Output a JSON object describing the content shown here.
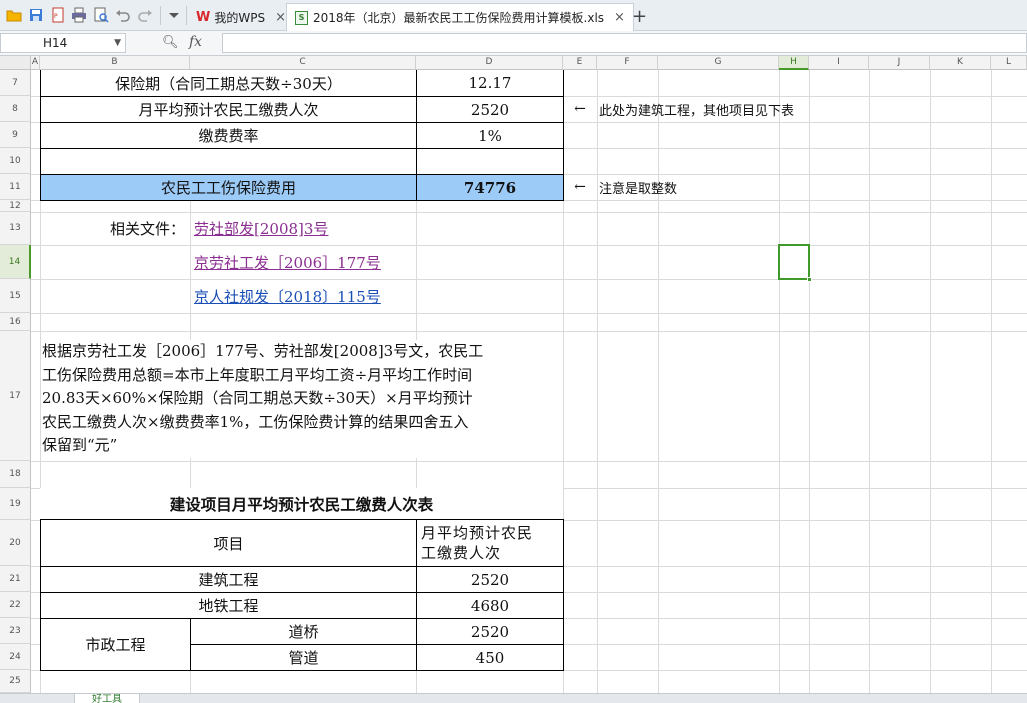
{
  "toolbar": {
    "icons": [
      "open-folder-icon",
      "save-icon",
      "export-pdf-icon",
      "print-icon",
      "print-preview-icon",
      "undo-icon",
      "redo-icon",
      "more-dropdown-icon"
    ]
  },
  "tabs": [
    {
      "label": "我的WPS",
      "close": "×",
      "active": false
    },
    {
      "label": "2018年（北京）最新农民工工伤保险费用计算模板.xls",
      "close": "×",
      "active": true
    }
  ],
  "new_tab": "+",
  "formula_bar": {
    "cell_ref": "H14",
    "fx": "fx",
    "content": ""
  },
  "columns": [
    "A",
    "B",
    "C",
    "D",
    "E",
    "F",
    "G",
    "H",
    "I",
    "J",
    "K",
    "L"
  ],
  "selected_column": "H",
  "rows": [
    "7",
    "8",
    "9",
    "10",
    "11",
    "12",
    "13",
    "14",
    "15",
    "16",
    "17",
    "18",
    "19",
    "20",
    "21",
    "22",
    "23",
    "24",
    "25"
  ],
  "selected_row": "14",
  "cells": {
    "r7_label": "保险期（合同工期总天数÷30天）",
    "r7_value": "12.17",
    "r8_label": "月平均预计农民工缴费人次",
    "r8_value": "2520",
    "r8_arrow": "←",
    "r8_note": "此处为建筑工程，其他项目见下表",
    "r9_label": "缴费费率",
    "r9_value": "1%",
    "r11_label": "农民工工伤保险费用",
    "r11_value": "74776",
    "r11_arrow": "←",
    "r11_note": "注意是取整数",
    "r13_label": "相关文件：",
    "r13_link": "劳社部发[2008]3号",
    "r14_link": "京劳社工发［2006］177号",
    "r15_link": "京人社规发〔2018〕115号",
    "r17_lines": [
      "根据京劳社工发［2006］177号、劳社部发[2008]3号文，农民工",
      "工伤保险费用总额=本市上年度职工月平均工资÷月平均工作时间",
      "20.83天×60%×保险期（合同工期总天数÷30天）×月平均预计",
      "农民工缴费人次×缴费费率1%，工伤保险费计算的结果四舍五入",
      "保留到“元”"
    ],
    "r19_title": "建设项目月平均预计农民工缴费人次表",
    "r20_item": "项目",
    "r20_count_lines": [
      "月平均预计农民",
      "工缴费人次"
    ],
    "r21_item": "建筑工程",
    "r21_value": "2520",
    "r22_item": "地铁工程",
    "r22_value": "4680",
    "r23_group": "市政工程",
    "r23_item": "道桥",
    "r23_value": "2520",
    "r24_item": "管道",
    "r24_value": "450"
  },
  "sheet_tab": "好工具",
  "colors": {
    "highlight_fill": "#9dcbf7",
    "selection": "#3f9a2a",
    "link": "#1a4fb5",
    "visited_link": "#8b2e91"
  }
}
